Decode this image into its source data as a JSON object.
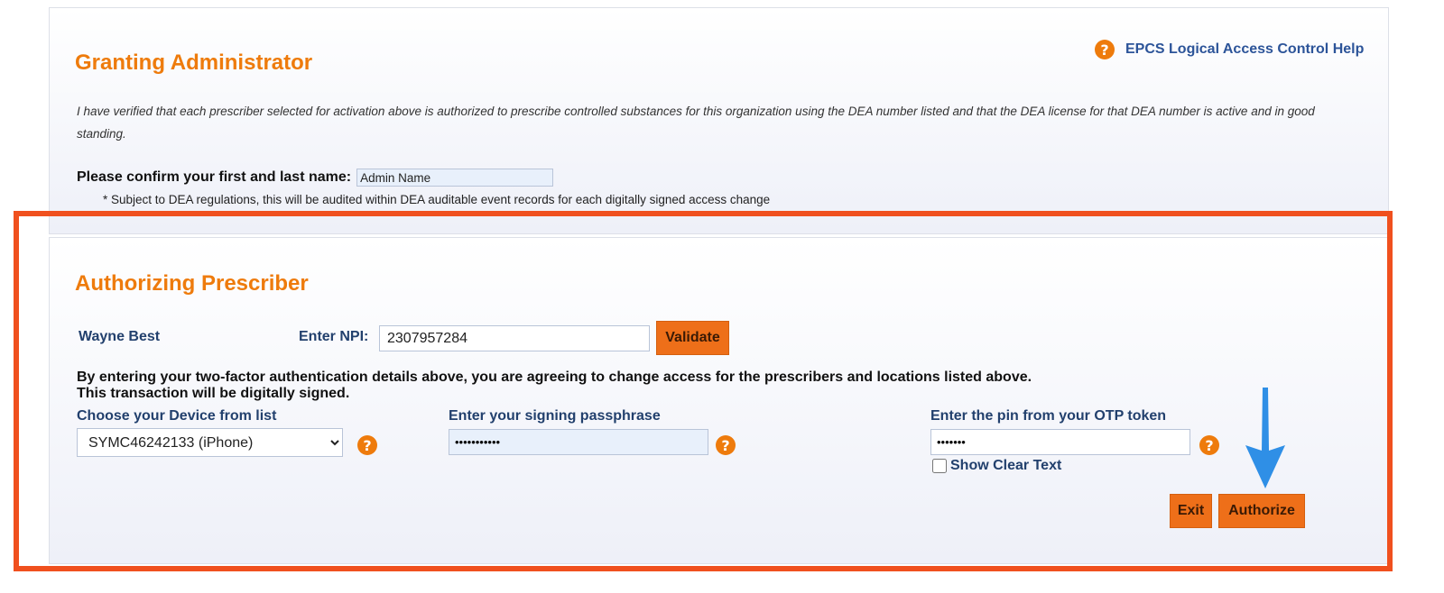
{
  "granting": {
    "title": "Granting Administrator",
    "help_link": "EPCS Logical Access Control Help",
    "statement": "I have verified that each prescriber selected for activation above is authorized to prescribe controlled substances for this organization using the DEA number listed and that the DEA license for that DEA number is active and in good standing.",
    "confirm_label": "Please confirm your first and last name:",
    "confirm_value": "Admin Name",
    "audit_note": "* Subject to DEA regulations, this will be audited within DEA auditable event records for each digitally signed access change"
  },
  "prescriber": {
    "title": "Authorizing Prescriber",
    "name": "Wayne Best",
    "npi_label": "Enter NPI:",
    "npi_value": "2307957284",
    "validate_label": "Validate",
    "agree_line1": "By entering your two-factor authentication details above, you are agreeing to change access for the prescribers and locations listed above.",
    "agree_line2": "This transaction will be digitally signed.",
    "device_label": "Choose your Device from list",
    "device_selected": "SYMC46242133 (iPhone)",
    "passphrase_label": "Enter your signing passphrase",
    "passphrase_value": "•••••••••••",
    "otp_label": "Enter the pin from your OTP token",
    "otp_value": "•••••••",
    "show_clear_label": "Show Clear Text",
    "exit_label": "Exit",
    "authorize_label": "Authorize"
  },
  "icons": {
    "help": "question-circle-icon",
    "help_glyph": "?",
    "arrow": "arrow-down-icon"
  },
  "colors": {
    "accent_orange": "#ee7b0c",
    "button_orange": "#ee6f19",
    "link_blue": "#2c5499",
    "highlight_red": "#f0501e",
    "arrow_blue": "#2f8fe6"
  }
}
